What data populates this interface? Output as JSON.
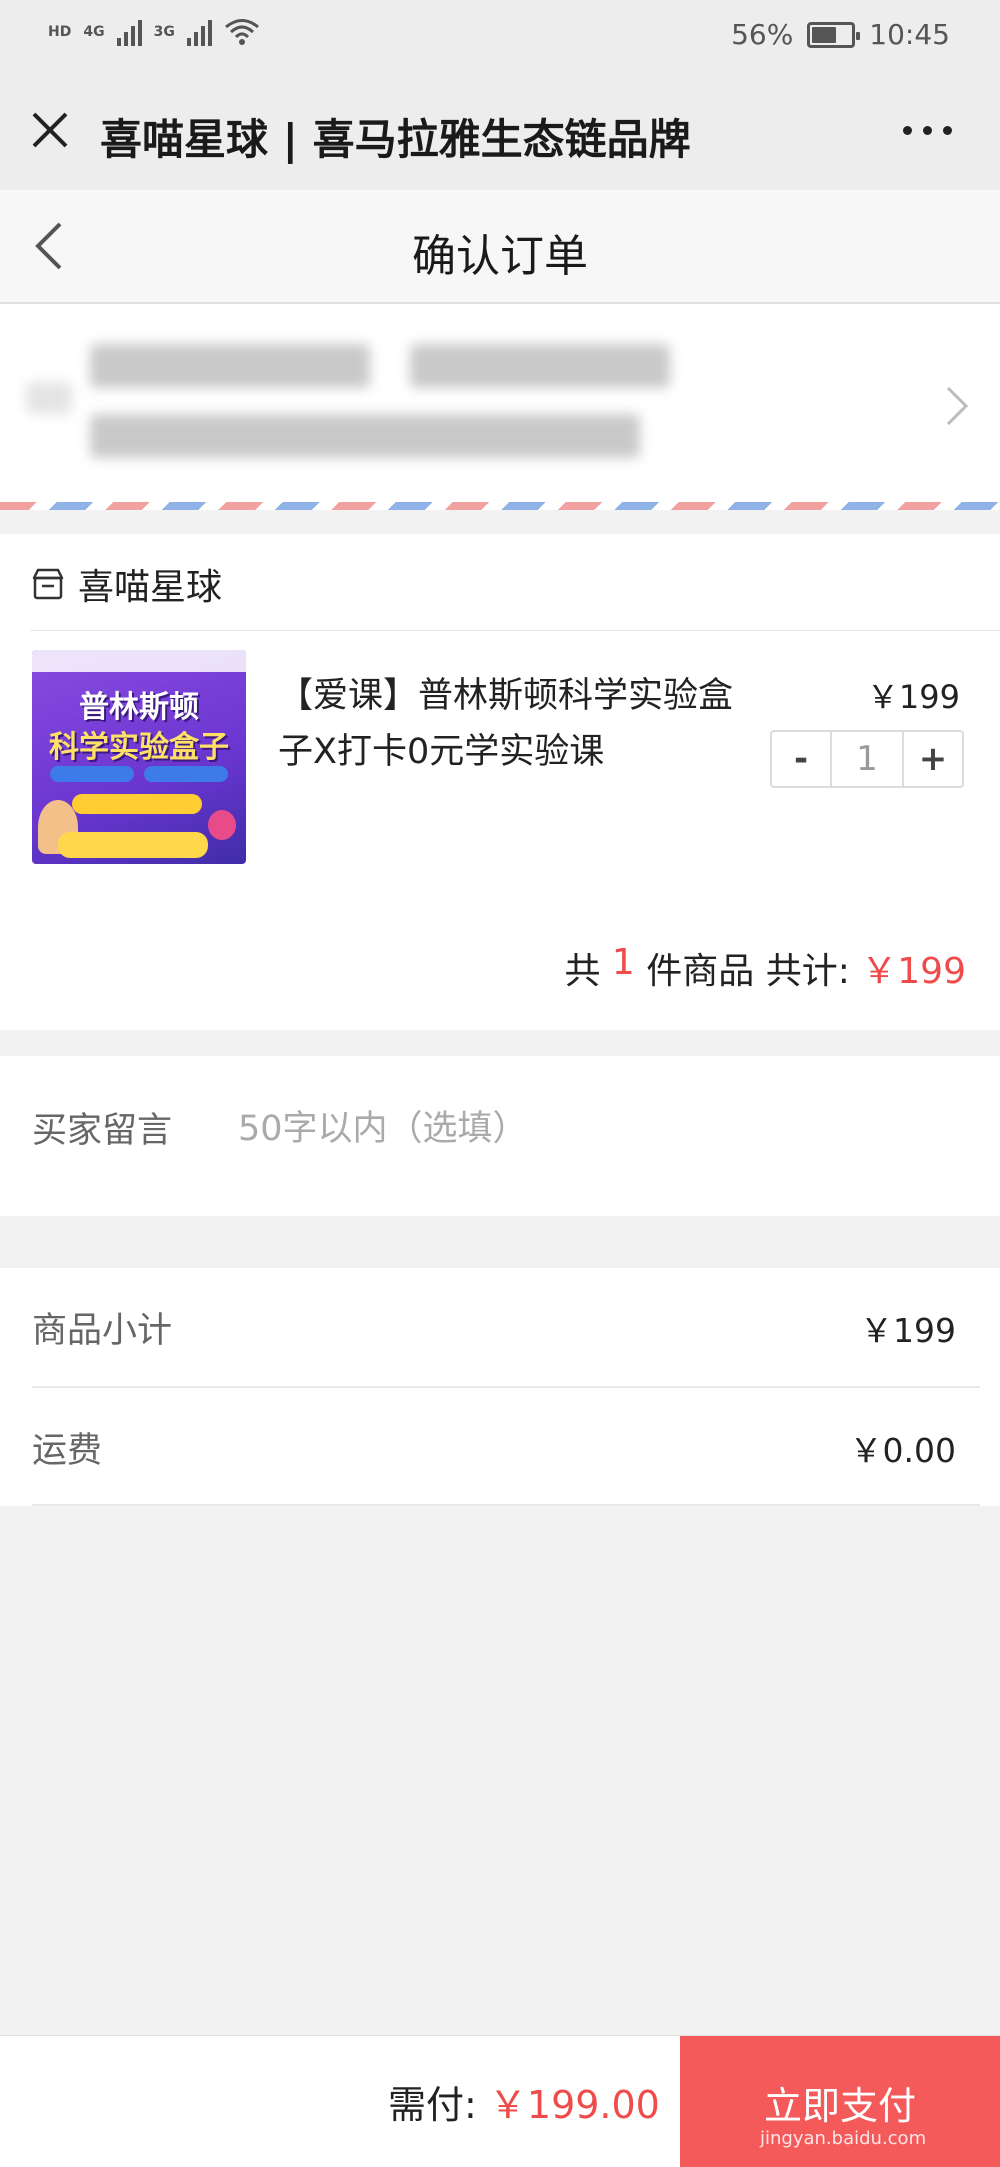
{
  "status_bar": {
    "network_hd": "HD",
    "network_4g": "4G",
    "network_3g": "3G",
    "battery_percent": "56%",
    "battery_level": 0.56,
    "time": "10:45"
  },
  "app_bar": {
    "title": "喜喵星球 | 喜马拉雅生态链品牌",
    "close_icon": "close-icon",
    "more_icon": "more-dots-icon"
  },
  "nav": {
    "title": "确认订单",
    "back_icon": "chevron-left-icon"
  },
  "shop": {
    "name": "喜喵星球",
    "icon": "store-icon",
    "product": {
      "image_title_line1": "普林斯顿",
      "image_title_line2": "科学实验盒子",
      "name": "【爱课】普林斯顿科学实验盒子X打卡0元学实验课",
      "price": "￥199",
      "quantity": "1",
      "minus_label": "-",
      "plus_label": "+"
    },
    "summary": {
      "prefix": "共 ",
      "count": "1",
      "suffix": " 件商品 共计: ",
      "total": "￥199"
    }
  },
  "message": {
    "label": "买家留言",
    "placeholder": "50字以内（选填）"
  },
  "totals": {
    "subtotal_label": "商品小计",
    "subtotal_value": "￥199",
    "shipping_label": "运费",
    "shipping_value": "￥0.00"
  },
  "bottom_bar": {
    "pay_label": "需付: ",
    "pay_amount": "￥199.00",
    "submit_label": "立即支付"
  },
  "watermark": "jingyan.baidu.com",
  "colors": {
    "accent_red": "#f04b4b",
    "submit_bg": "#f45a5a",
    "header_bg": "#ededed",
    "page_bg": "#f2f2f2"
  }
}
